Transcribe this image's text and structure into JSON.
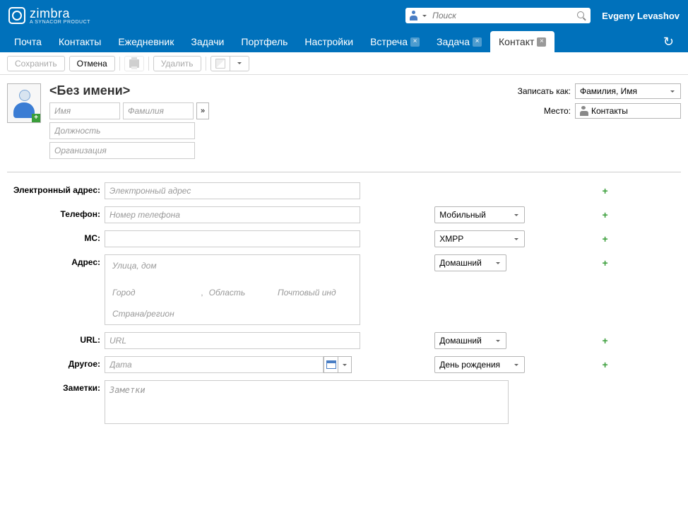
{
  "header": {
    "logo": "zimbra",
    "sublogo": "A SYNACOR PRODUCT",
    "search_placeholder": "Поиск",
    "user": "Evgeny Levashov"
  },
  "nav": {
    "tabs": [
      "Почта",
      "Контакты",
      "Ежедневник",
      "Задачи",
      "Портфель",
      "Настройки"
    ],
    "dyn_tabs": [
      "Встреча",
      "Задача",
      "Контакт"
    ],
    "active_index": 2
  },
  "toolbar": {
    "save": "Сохранить",
    "cancel": "Отмена",
    "delete": "Удалить"
  },
  "contact": {
    "display_name": "<Без имени>",
    "first_ph": "Имя",
    "last_ph": "Фамилия",
    "expand": "»",
    "job_ph": "Должность",
    "org_ph": "Организация"
  },
  "options": {
    "save_as_label": "Записать как:",
    "save_as_value": "Фамилия, Имя",
    "location_label": "Место:",
    "location_value": "Контакты"
  },
  "fields": {
    "email_label": "Электронный адрес:",
    "email_ph": "Электронный адрес",
    "phone_label": "Телефон:",
    "phone_ph": "Номер телефона",
    "phone_type": "Мобильный",
    "im_label": "МС:",
    "im_type": "XMPP",
    "address_label": "Адрес:",
    "street_ph": "Улица, дом",
    "city_ph": "Город",
    "comma": ",",
    "region_ph": "Область",
    "zip_ph": "Почтовый инд",
    "country_ph": "Страна/регион",
    "address_type": "Домашний",
    "url_label": "URL:",
    "url_ph": "URL",
    "url_type": "Домашний",
    "other_label": "Другое:",
    "date_ph": "Дата",
    "other_type": "День рождения",
    "notes_label": "Заметки:",
    "notes_ph": "Заметки"
  }
}
